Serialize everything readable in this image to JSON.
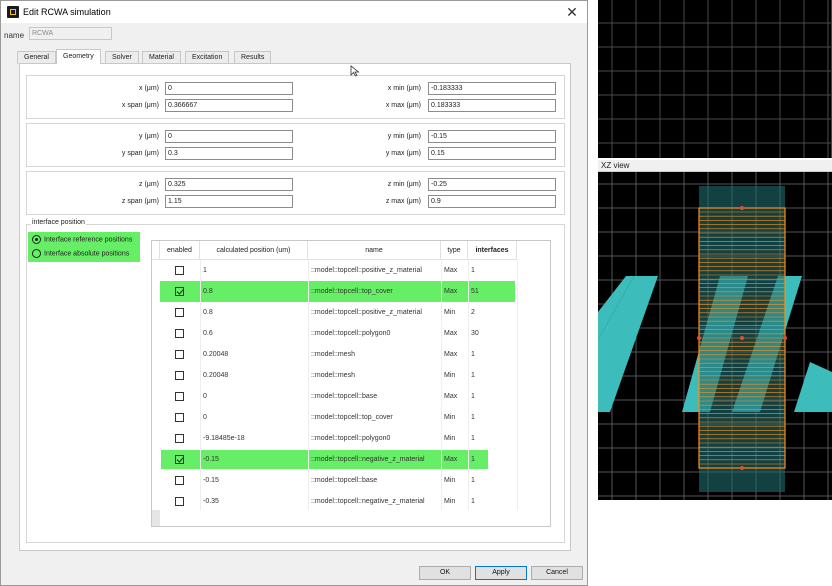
{
  "window": {
    "title": "Edit RCWA simulation"
  },
  "name_field": {
    "label": "name",
    "value": "RCWA"
  },
  "tabs": [
    {
      "label": "General",
      "active": false
    },
    {
      "label": "Geometry",
      "active": true
    },
    {
      "label": "Solver",
      "active": false
    },
    {
      "label": "Material",
      "active": false
    },
    {
      "label": "Excitation",
      "active": false
    },
    {
      "label": "Results",
      "active": false
    }
  ],
  "geometry": {
    "x": {
      "label": "x (μm)",
      "value": "0"
    },
    "x_span": {
      "label": "x span (μm)",
      "value": "0.366667"
    },
    "x_min": {
      "label": "x min (μm)",
      "value": "-0.183333"
    },
    "x_max": {
      "label": "x max (μm)",
      "value": "0.183333"
    },
    "y": {
      "label": "y (μm)",
      "value": "0"
    },
    "y_span": {
      "label": "y span (μm)",
      "value": "0.3"
    },
    "y_min": {
      "label": "y min (μm)",
      "value": "-0.15"
    },
    "y_max": {
      "label": "y max (μm)",
      "value": "0.15"
    },
    "z": {
      "label": "z (μm)",
      "value": "0.325"
    },
    "z_span": {
      "label": "z span (μm)",
      "value": "1.15"
    },
    "z_min": {
      "label": "z min (μm)",
      "value": "-0.25"
    },
    "z_max": {
      "label": "z max (μm)",
      "value": "0.9"
    }
  },
  "interface": {
    "legend": "interface position",
    "options": [
      {
        "label": "Interface reference positions",
        "selected": true
      },
      {
        "label": "Interface absolute positions",
        "selected": false
      }
    ],
    "columns": [
      "enabled",
      "calculated position (um)",
      "name",
      "type",
      "interfaces"
    ],
    "rows": [
      {
        "enabled": false,
        "position": "1",
        "name": "::model::topcell::positive_z_material",
        "type": "Max",
        "interfaces": "1"
      },
      {
        "enabled": true,
        "position": "0.8",
        "name": "::model::topcell::top_cover",
        "type": "Max",
        "interfaces": "51"
      },
      {
        "enabled": false,
        "position": "0.8",
        "name": "::model::topcell::positive_z_material",
        "type": "Min",
        "interfaces": "2"
      },
      {
        "enabled": false,
        "position": "0.6",
        "name": "::model::topcell::polygon0",
        "type": "Max",
        "interfaces": "30"
      },
      {
        "enabled": false,
        "position": "0.20048",
        "name": "::model::mesh",
        "type": "Max",
        "interfaces": "1"
      },
      {
        "enabled": false,
        "position": "0.20048",
        "name": "::model::mesh",
        "type": "Min",
        "interfaces": "1"
      },
      {
        "enabled": false,
        "position": "0",
        "name": "::model::topcell::base",
        "type": "Max",
        "interfaces": "1"
      },
      {
        "enabled": false,
        "position": "0",
        "name": "::model::topcell::top_cover",
        "type": "Min",
        "interfaces": "1"
      },
      {
        "enabled": false,
        "position": "-9.18485e-18",
        "name": "::model::topcell::polygon0",
        "type": "Min",
        "interfaces": "1"
      },
      {
        "enabled": true,
        "position": "-0.15",
        "name": "::model::topcell::negative_z_material",
        "type": "Max",
        "interfaces": "1"
      },
      {
        "enabled": false,
        "position": "-0.15",
        "name": "::model::topcell::base",
        "type": "Min",
        "interfaces": "1"
      },
      {
        "enabled": false,
        "position": "-0.35",
        "name": "::model::topcell::negative_z_material",
        "type": "Min",
        "interfaces": "1"
      }
    ]
  },
  "buttons": {
    "ok": "OK",
    "apply": "Apply",
    "cancel": "Cancel"
  },
  "xz_view": {
    "title": "XZ view"
  },
  "colors": {
    "highlight": "#66ee66",
    "structure": "#3dbcbc",
    "region": "#ff8c1a",
    "grid": "#555555"
  }
}
